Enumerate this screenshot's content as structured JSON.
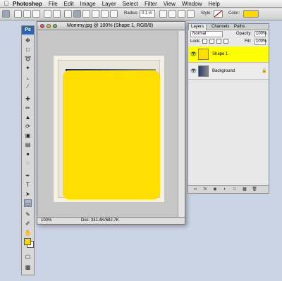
{
  "menubar": {
    "app_name": "Photoshop",
    "menus": [
      "File",
      "Edit",
      "Image",
      "Layer",
      "Select",
      "Filter",
      "View",
      "Window",
      "Help"
    ]
  },
  "options": {
    "radius_label": "Radius:",
    "radius_value": "0.1 in",
    "style_label": "Style:",
    "color_label": "Color:",
    "color_value": "#ffd800"
  },
  "tools": {
    "logo": "Ps",
    "foreground_color": "#ffd800",
    "background_color": "#ffffff"
  },
  "document": {
    "title": "Mommy.jpg @ 100% (Shape 1, RGB/8)",
    "zoom": "100%",
    "doc_info": "Doc: 341.4K/682.7K",
    "shape_color": "#ffde00"
  },
  "layers_panel": {
    "tabs": [
      "Layers",
      "Channels",
      "Paths"
    ],
    "blend_mode": "Normal",
    "opacity_label": "Opacity:",
    "opacity_value": "100%",
    "lock_label": "Lock:",
    "fill_label": "Fill:",
    "fill_value": "100%",
    "layers": [
      {
        "name": "Shape 1",
        "selected": true
      },
      {
        "name": "Background",
        "selected": false
      }
    ]
  }
}
